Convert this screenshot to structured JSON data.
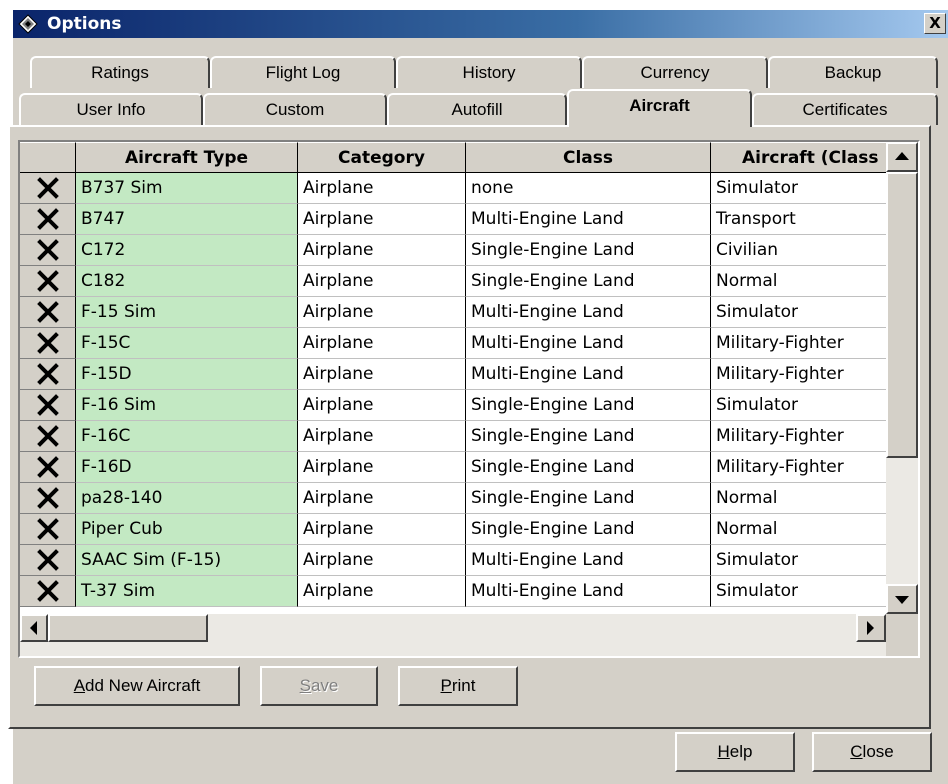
{
  "window": {
    "title": "Options",
    "close_glyph": "X"
  },
  "tabs_row1": [
    "Ratings",
    "Flight Log",
    "History",
    "Currency",
    "Backup"
  ],
  "tabs_row2": [
    "User Info",
    "Custom",
    "Autofill",
    "Aircraft",
    "Certificates"
  ],
  "active_tab": "Aircraft",
  "table": {
    "columns": [
      "",
      "Aircraft Type",
      "Category",
      "Class",
      "Aircraft (Class"
    ],
    "rows": [
      [
        "B737 Sim",
        "Airplane",
        "none",
        "Simulator"
      ],
      [
        "B747",
        "Airplane",
        "Multi-Engine Land",
        "Transport"
      ],
      [
        "C172",
        "Airplane",
        "Single-Engine Land",
        "Civilian"
      ],
      [
        "C182",
        "Airplane",
        "Single-Engine Land",
        "Normal"
      ],
      [
        "F-15 Sim",
        "Airplane",
        "Multi-Engine Land",
        "Simulator"
      ],
      [
        "F-15C",
        "Airplane",
        "Multi-Engine Land",
        "Military-Fighter"
      ],
      [
        "F-15D",
        "Airplane",
        "Multi-Engine Land",
        "Military-Fighter"
      ],
      [
        "F-16 Sim",
        "Airplane",
        "Single-Engine Land",
        "Simulator"
      ],
      [
        "F-16C",
        "Airplane",
        "Single-Engine Land",
        "Military-Fighter"
      ],
      [
        "F-16D",
        "Airplane",
        "Single-Engine Land",
        "Military-Fighter"
      ],
      [
        "pa28-140",
        "Airplane",
        "Single-Engine Land",
        "Normal"
      ],
      [
        "Piper Cub",
        "Airplane",
        "Single-Engine Land",
        "Normal"
      ],
      [
        "SAAC Sim (F-15)",
        "Airplane",
        "Multi-Engine Land",
        "Simulator"
      ],
      [
        "T-37 Sim",
        "Airplane",
        "Multi-Engine Land",
        "Simulator"
      ]
    ],
    "delete_icon": "x-delete-icon"
  },
  "buttons": {
    "add_new_aircraft": {
      "mnemonic": "A",
      "rest": "dd New Aircraft"
    },
    "save": {
      "mnemonic": "S",
      "rest": "ave"
    },
    "print": {
      "mnemonic": "P",
      "rest": "rint"
    },
    "help": {
      "mnemonic": "H",
      "rest": "elp"
    },
    "close": {
      "mnemonic": "C",
      "rest": "lose"
    }
  },
  "colors": {
    "title_gradient_start": "#0a246a",
    "aircraft_type_column": "#c3e9c3",
    "dialog_face": "#d4d0c8"
  }
}
